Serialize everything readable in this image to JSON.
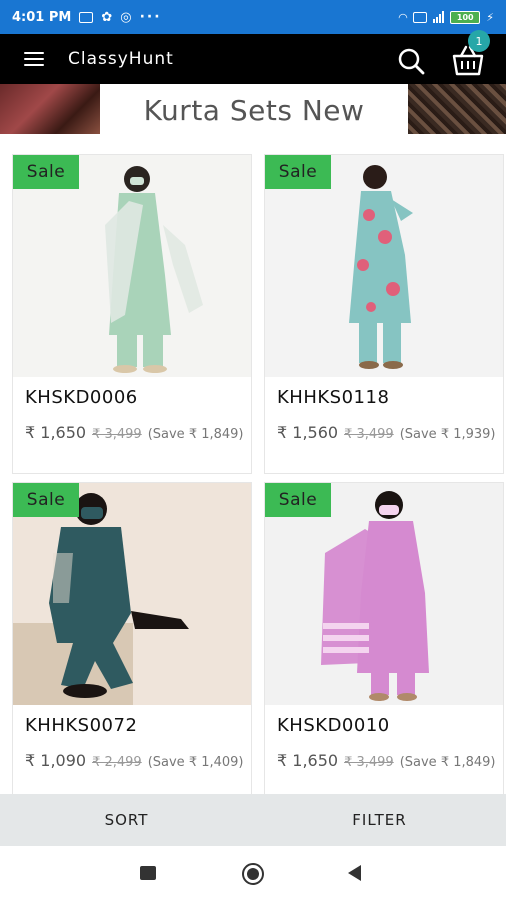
{
  "status_bar": {
    "time": "4:01 PM",
    "battery": "100"
  },
  "app_bar": {
    "title": "ClassyHunt",
    "cart_count": "1"
  },
  "banner": {
    "title": "Kurta Sets New"
  },
  "products": [
    {
      "badge": "Sale",
      "code": "KHSKD0006",
      "price": "₹ 1,650",
      "mrp": "₹ 3,499",
      "save": "(Save ₹ 1,849)",
      "colors": {
        "bg": "#f4f4f2",
        "outfit": "#a9d3b9",
        "accent": "#dfe8e2"
      }
    },
    {
      "badge": "Sale",
      "code": "KHHKS0118",
      "price": "₹ 1,560",
      "mrp": "₹ 3,499",
      "save": "(Save ₹ 1,939)",
      "colors": {
        "bg": "#f3f3f3",
        "outfit": "#86c4c2",
        "accent": "#e0607a"
      }
    },
    {
      "badge": "Sale",
      "code": "KHHKS0072",
      "price": "₹ 1,090",
      "mrp": "₹ 2,499",
      "save": "(Save ₹ 1,409)",
      "colors": {
        "bg": "#efe4da",
        "outfit": "#2f5a60",
        "accent": "#d8c8b4"
      }
    },
    {
      "badge": "Sale",
      "code": "KHSKD0010",
      "price": "₹ 1,650",
      "mrp": "₹ 3,499",
      "save": "(Save ₹ 1,849)",
      "colors": {
        "bg": "#f2f2f2",
        "outfit": "#d58ad0",
        "accent": "#f4d4ef"
      }
    }
  ],
  "actions": {
    "sort": "SORT",
    "filter": "FILTER"
  }
}
